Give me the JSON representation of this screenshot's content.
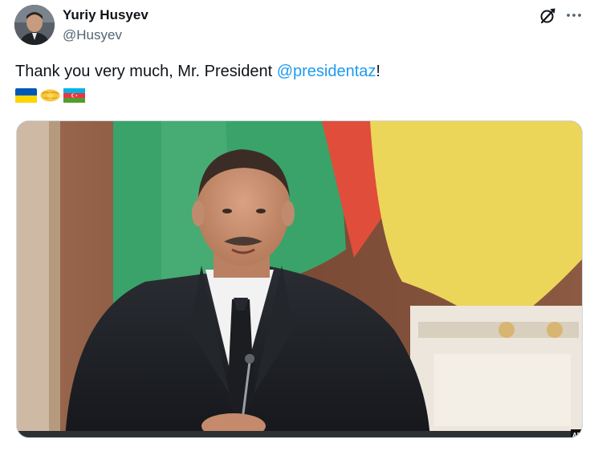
{
  "tweet": {
    "author": {
      "name": "Yuriy Husyev",
      "handle": "@Husyev"
    },
    "text": {
      "before": "Thank you very much, Mr. President ",
      "mention": "@presidentaz",
      "after": "!"
    },
    "emojis": [
      "ukraine-flag",
      "handshake",
      "azerbaijan-flag"
    ],
    "media": {
      "type": "photo",
      "watermark": "AP"
    }
  },
  "colors": {
    "text": "#0f1419",
    "secondary": "#536471",
    "link": "#1d9bf0",
    "border": "#cfd9de"
  }
}
